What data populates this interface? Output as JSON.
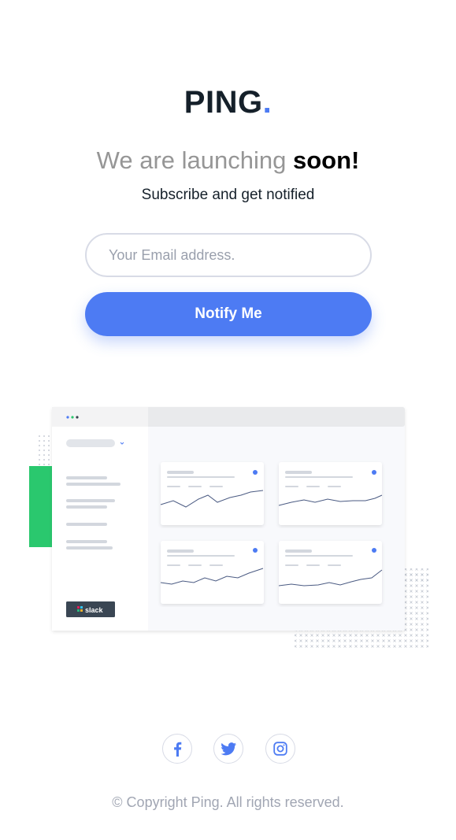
{
  "brand": {
    "name": "PING",
    "dot": "."
  },
  "headline": {
    "light": "We are launching ",
    "bold": "soon!"
  },
  "subtitle": "Subscribe and get notified",
  "form": {
    "email_placeholder": "Your Email address.",
    "email_value": "",
    "submit_label": "Notify Me"
  },
  "illustration": {
    "slack_label": "slack"
  },
  "social": [
    {
      "name": "facebook-icon"
    },
    {
      "name": "twitter-icon"
    },
    {
      "name": "instagram-icon"
    }
  ],
  "footer": {
    "copyright": "© Copyright Ping. All rights reserved."
  },
  "colors": {
    "accent": "#4d7bf3",
    "dark": "#15202a",
    "muted": "#969696",
    "green": "#2ac86e"
  }
}
